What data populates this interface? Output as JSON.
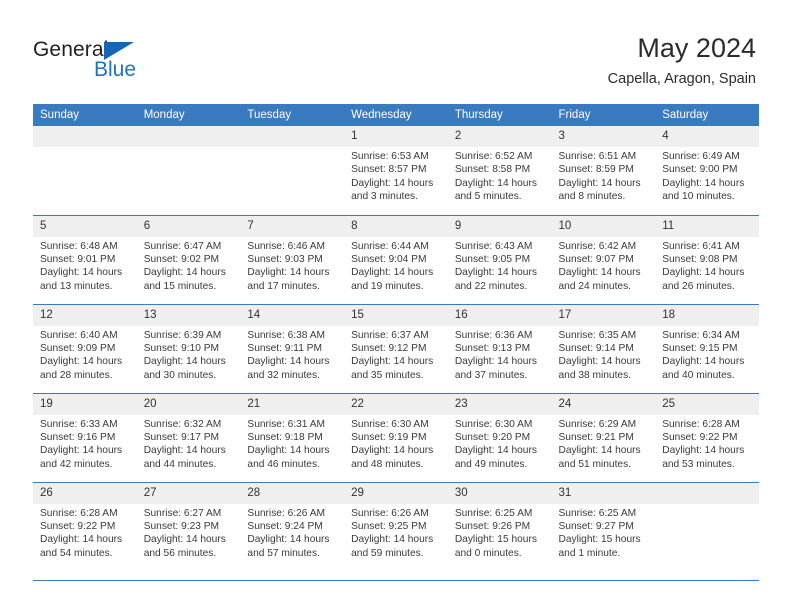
{
  "brand": {
    "name_top": "General",
    "name_bottom": "Blue",
    "logo_icon": "triangle-flag-icon",
    "colors": {
      "blue": "#1b75bb",
      "dark": "#231f20"
    }
  },
  "header": {
    "title": "May 2024",
    "subtitle": "Capella, Aragon, Spain"
  },
  "theme": {
    "header_blue": "#3a7ac0",
    "daynum_band": "#efefef",
    "text": "#3a3a3a"
  },
  "calendar": {
    "weekday_headers": [
      "Sunday",
      "Monday",
      "Tuesday",
      "Wednesday",
      "Thursday",
      "Friday",
      "Saturday"
    ],
    "weeks": [
      [
        {
          "day": "",
          "empty": true
        },
        {
          "day": "",
          "empty": true
        },
        {
          "day": "",
          "empty": true
        },
        {
          "day": "1",
          "sunrise": "Sunrise: 6:53 AM",
          "sunset": "Sunset: 8:57 PM",
          "daylight_l1": "Daylight: 14 hours",
          "daylight_l2": "and 3 minutes."
        },
        {
          "day": "2",
          "sunrise": "Sunrise: 6:52 AM",
          "sunset": "Sunset: 8:58 PM",
          "daylight_l1": "Daylight: 14 hours",
          "daylight_l2": "and 5 minutes."
        },
        {
          "day": "3",
          "sunrise": "Sunrise: 6:51 AM",
          "sunset": "Sunset: 8:59 PM",
          "daylight_l1": "Daylight: 14 hours",
          "daylight_l2": "and 8 minutes."
        },
        {
          "day": "4",
          "sunrise": "Sunrise: 6:49 AM",
          "sunset": "Sunset: 9:00 PM",
          "daylight_l1": "Daylight: 14 hours",
          "daylight_l2": "and 10 minutes."
        }
      ],
      [
        {
          "day": "5",
          "sunrise": "Sunrise: 6:48 AM",
          "sunset": "Sunset: 9:01 PM",
          "daylight_l1": "Daylight: 14 hours",
          "daylight_l2": "and 13 minutes."
        },
        {
          "day": "6",
          "sunrise": "Sunrise: 6:47 AM",
          "sunset": "Sunset: 9:02 PM",
          "daylight_l1": "Daylight: 14 hours",
          "daylight_l2": "and 15 minutes."
        },
        {
          "day": "7",
          "sunrise": "Sunrise: 6:46 AM",
          "sunset": "Sunset: 9:03 PM",
          "daylight_l1": "Daylight: 14 hours",
          "daylight_l2": "and 17 minutes."
        },
        {
          "day": "8",
          "sunrise": "Sunrise: 6:44 AM",
          "sunset": "Sunset: 9:04 PM",
          "daylight_l1": "Daylight: 14 hours",
          "daylight_l2": "and 19 minutes."
        },
        {
          "day": "9",
          "sunrise": "Sunrise: 6:43 AM",
          "sunset": "Sunset: 9:05 PM",
          "daylight_l1": "Daylight: 14 hours",
          "daylight_l2": "and 22 minutes."
        },
        {
          "day": "10",
          "sunrise": "Sunrise: 6:42 AM",
          "sunset": "Sunset: 9:07 PM",
          "daylight_l1": "Daylight: 14 hours",
          "daylight_l2": "and 24 minutes."
        },
        {
          "day": "11",
          "sunrise": "Sunrise: 6:41 AM",
          "sunset": "Sunset: 9:08 PM",
          "daylight_l1": "Daylight: 14 hours",
          "daylight_l2": "and 26 minutes."
        }
      ],
      [
        {
          "day": "12",
          "sunrise": "Sunrise: 6:40 AM",
          "sunset": "Sunset: 9:09 PM",
          "daylight_l1": "Daylight: 14 hours",
          "daylight_l2": "and 28 minutes."
        },
        {
          "day": "13",
          "sunrise": "Sunrise: 6:39 AM",
          "sunset": "Sunset: 9:10 PM",
          "daylight_l1": "Daylight: 14 hours",
          "daylight_l2": "and 30 minutes."
        },
        {
          "day": "14",
          "sunrise": "Sunrise: 6:38 AM",
          "sunset": "Sunset: 9:11 PM",
          "daylight_l1": "Daylight: 14 hours",
          "daylight_l2": "and 32 minutes."
        },
        {
          "day": "15",
          "sunrise": "Sunrise: 6:37 AM",
          "sunset": "Sunset: 9:12 PM",
          "daylight_l1": "Daylight: 14 hours",
          "daylight_l2": "and 35 minutes."
        },
        {
          "day": "16",
          "sunrise": "Sunrise: 6:36 AM",
          "sunset": "Sunset: 9:13 PM",
          "daylight_l1": "Daylight: 14 hours",
          "daylight_l2": "and 37 minutes."
        },
        {
          "day": "17",
          "sunrise": "Sunrise: 6:35 AM",
          "sunset": "Sunset: 9:14 PM",
          "daylight_l1": "Daylight: 14 hours",
          "daylight_l2": "and 38 minutes."
        },
        {
          "day": "18",
          "sunrise": "Sunrise: 6:34 AM",
          "sunset": "Sunset: 9:15 PM",
          "daylight_l1": "Daylight: 14 hours",
          "daylight_l2": "and 40 minutes."
        }
      ],
      [
        {
          "day": "19",
          "sunrise": "Sunrise: 6:33 AM",
          "sunset": "Sunset: 9:16 PM",
          "daylight_l1": "Daylight: 14 hours",
          "daylight_l2": "and 42 minutes."
        },
        {
          "day": "20",
          "sunrise": "Sunrise: 6:32 AM",
          "sunset": "Sunset: 9:17 PM",
          "daylight_l1": "Daylight: 14 hours",
          "daylight_l2": "and 44 minutes."
        },
        {
          "day": "21",
          "sunrise": "Sunrise: 6:31 AM",
          "sunset": "Sunset: 9:18 PM",
          "daylight_l1": "Daylight: 14 hours",
          "daylight_l2": "and 46 minutes."
        },
        {
          "day": "22",
          "sunrise": "Sunrise: 6:30 AM",
          "sunset": "Sunset: 9:19 PM",
          "daylight_l1": "Daylight: 14 hours",
          "daylight_l2": "and 48 minutes."
        },
        {
          "day": "23",
          "sunrise": "Sunrise: 6:30 AM",
          "sunset": "Sunset: 9:20 PM",
          "daylight_l1": "Daylight: 14 hours",
          "daylight_l2": "and 49 minutes."
        },
        {
          "day": "24",
          "sunrise": "Sunrise: 6:29 AM",
          "sunset": "Sunset: 9:21 PM",
          "daylight_l1": "Daylight: 14 hours",
          "daylight_l2": "and 51 minutes."
        },
        {
          "day": "25",
          "sunrise": "Sunrise: 6:28 AM",
          "sunset": "Sunset: 9:22 PM",
          "daylight_l1": "Daylight: 14 hours",
          "daylight_l2": "and 53 minutes."
        }
      ],
      [
        {
          "day": "26",
          "sunrise": "Sunrise: 6:28 AM",
          "sunset": "Sunset: 9:22 PM",
          "daylight_l1": "Daylight: 14 hours",
          "daylight_l2": "and 54 minutes."
        },
        {
          "day": "27",
          "sunrise": "Sunrise: 6:27 AM",
          "sunset": "Sunset: 9:23 PM",
          "daylight_l1": "Daylight: 14 hours",
          "daylight_l2": "and 56 minutes."
        },
        {
          "day": "28",
          "sunrise": "Sunrise: 6:26 AM",
          "sunset": "Sunset: 9:24 PM",
          "daylight_l1": "Daylight: 14 hours",
          "daylight_l2": "and 57 minutes."
        },
        {
          "day": "29",
          "sunrise": "Sunrise: 6:26 AM",
          "sunset": "Sunset: 9:25 PM",
          "daylight_l1": "Daylight: 14 hours",
          "daylight_l2": "and 59 minutes."
        },
        {
          "day": "30",
          "sunrise": "Sunrise: 6:25 AM",
          "sunset": "Sunset: 9:26 PM",
          "daylight_l1": "Daylight: 15 hours",
          "daylight_l2": "and 0 minutes."
        },
        {
          "day": "31",
          "sunrise": "Sunrise: 6:25 AM",
          "sunset": "Sunset: 9:27 PM",
          "daylight_l1": "Daylight: 15 hours",
          "daylight_l2": "and 1 minute."
        },
        {
          "day": "",
          "empty": true
        }
      ]
    ]
  }
}
